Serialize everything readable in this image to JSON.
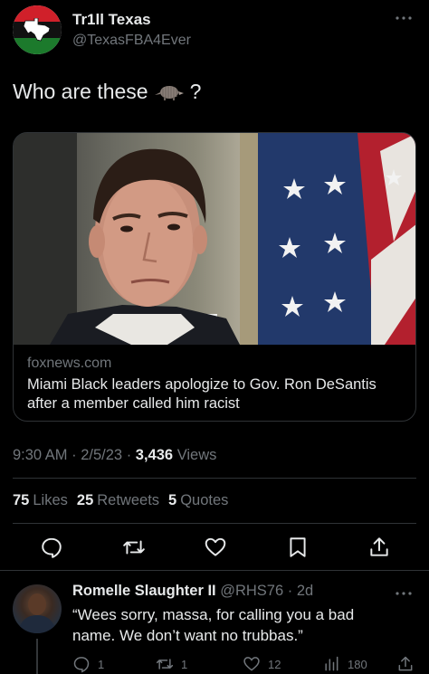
{
  "tweet": {
    "author_name": "Tr1ll Texas",
    "author_handle": "@TexasFBA4Ever",
    "text": "Who are these",
    "text_suffix": "?",
    "inline_emoji": "armadillo-emoji"
  },
  "card": {
    "domain": "foxnews.com",
    "title": "Miami Black leaders apologize to Gov. Ron DeSantis after a member called him racist",
    "image": "photo-man-with-american-flag"
  },
  "meta": {
    "time": "9:30 AM",
    "date": "2/5/23",
    "views_count": "3,436",
    "views_label": "Views"
  },
  "stats": {
    "likes_count": "75",
    "likes_label": "Likes",
    "retweets_count": "25",
    "retweets_label": "Retweets",
    "quotes_count": "5",
    "quotes_label": "Quotes"
  },
  "actions": [
    "reply-icon",
    "retweet-icon",
    "like-icon",
    "bookmark-icon",
    "share-icon"
  ],
  "reply": {
    "author_name": "Romelle Slaughter II",
    "author_handle": "@RHS76",
    "age": "2d",
    "text": "“Wees sorry, massa, for calling you a bad name. We don’t want no trubbas.”",
    "reply_count": "1",
    "retweet_count": "1",
    "like_count": "12",
    "views_count": "180"
  },
  "colors": {
    "background": "#000000",
    "text": "#e7e9ea",
    "secondary": "#71767b",
    "border": "#2f3336"
  }
}
